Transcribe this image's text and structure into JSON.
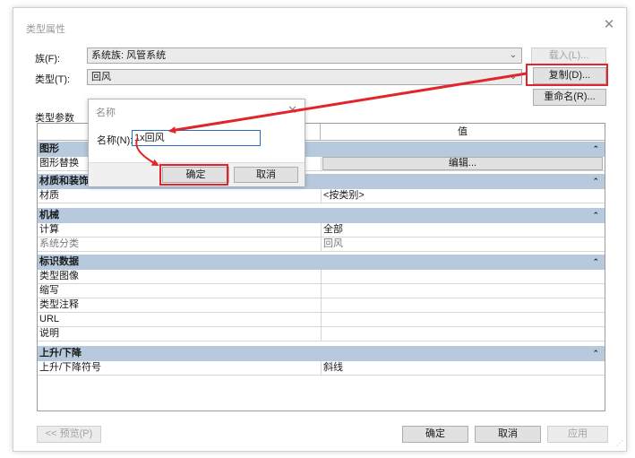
{
  "window": {
    "title": "类型属性",
    "close_icon": "close-icon"
  },
  "family": {
    "label": "族(F):",
    "value": "系统族: 风管系统"
  },
  "type": {
    "label": "类型(T):",
    "value": "回风"
  },
  "buttons": {
    "load": "载入(L)...",
    "duplicate": "复制(D)...",
    "rename": "重命名(R)...",
    "preview": "<< 预览(P)",
    "ok": "确定",
    "cancel": "取消",
    "apply": "应用"
  },
  "type_params_label": "类型参数",
  "grid": {
    "columns": {
      "parameter": "",
      "value": "值"
    },
    "sections": [
      {
        "name": "图形",
        "rows": [
          {
            "param": "图形替换",
            "value": "编辑...",
            "is_button": true
          }
        ]
      },
      {
        "name": "材质和装饰",
        "rows": [
          {
            "param": "材质",
            "value": "<按类别>"
          }
        ]
      },
      {
        "name": "机械",
        "rows": [
          {
            "param": "计算",
            "value": "全部"
          },
          {
            "param": "系统分类",
            "value": "回风",
            "greyed": true
          }
        ]
      },
      {
        "name": "标识数据",
        "rows": [
          {
            "param": "类型图像",
            "value": ""
          },
          {
            "param": "缩写",
            "value": ""
          },
          {
            "param": "类型注释",
            "value": ""
          },
          {
            "param": "URL",
            "value": ""
          },
          {
            "param": "说明",
            "value": ""
          }
        ]
      },
      {
        "name": "上升/下降",
        "rows": [
          {
            "param": "上升/下降符号",
            "value": "斜线"
          }
        ]
      }
    ]
  },
  "name_dialog": {
    "title": "名称",
    "close_icon": "close-icon",
    "name_label": "名称(N):",
    "name_value": "1x回风",
    "ok": "确定",
    "cancel": "取消"
  },
  "colors": {
    "highlight": "#e0262b",
    "section_header": "#b6c9dd",
    "input_focus": "#2b6cc4"
  }
}
